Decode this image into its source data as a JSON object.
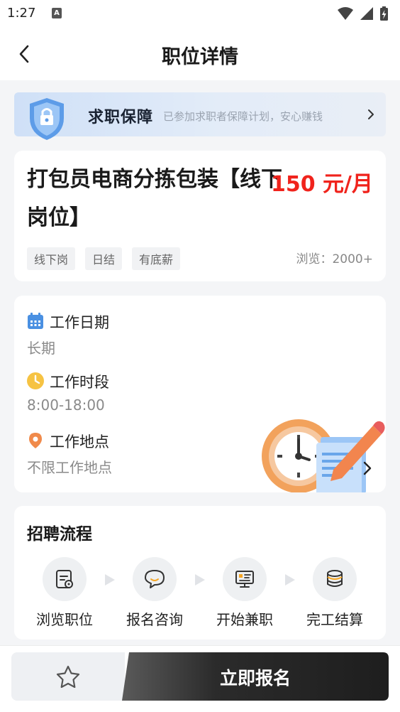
{
  "status_bar": {
    "time": "1:27",
    "notification_glyph": "A",
    "icons": [
      "wifi-icon",
      "signal-icon",
      "battery-icon"
    ]
  },
  "nav": {
    "title": "职位详情",
    "back_icon": "back-chevron-icon"
  },
  "guarantee": {
    "title": "求职保障",
    "description": "已参加求职者保障计划，安心赚钱",
    "icon": "shield-lock-icon"
  },
  "job": {
    "title": "打包员电商分拣包装【线下岗位】",
    "salary": "150 元/月",
    "tags": [
      "线下岗",
      "日结",
      "有底薪"
    ],
    "views": "浏览：2000+"
  },
  "work_info": {
    "date": {
      "label": "工作日期",
      "value": "长期",
      "icon": "calendar-icon"
    },
    "hours": {
      "label": "工作时段",
      "value": "8:00-18:00",
      "icon": "clock-icon"
    },
    "location": {
      "label": "工作地点",
      "value": "不限工作地点",
      "icon": "location-pin-icon"
    }
  },
  "process": {
    "title": "招聘流程",
    "steps": [
      {
        "label": "浏览职位",
        "icon": "browse-job-icon"
      },
      {
        "label": "报名咨询",
        "icon": "chat-bubble-icon"
      },
      {
        "label": "开始兼职",
        "icon": "monitor-icon"
      },
      {
        "label": "完工结算",
        "icon": "coins-icon"
      }
    ]
  },
  "bottom": {
    "apply_label": "立即报名",
    "favorite_icon": "star-icon"
  },
  "colors": {
    "accent_red": "#f0231c",
    "calendar_blue": "#4a90e2",
    "clock_yellow": "#f6c343",
    "pin_orange": "#f08a4b",
    "apply_dark": "#2a2a2a"
  }
}
